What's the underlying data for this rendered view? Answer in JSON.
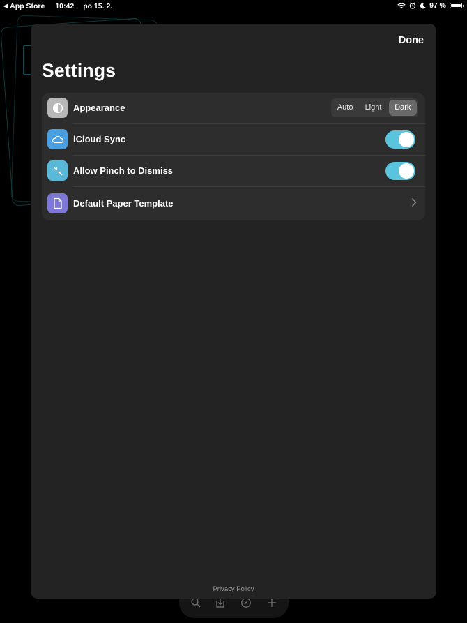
{
  "status_bar": {
    "back_label": "App Store",
    "time": "10:42",
    "date": "po 15. 2.",
    "battery": "97 %"
  },
  "sheet": {
    "done_label": "Done",
    "title": "Settings",
    "rows": [
      {
        "label": "Appearance",
        "icon": "contrast-icon"
      },
      {
        "label": "iCloud Sync",
        "icon": "cloud-icon",
        "toggle": true
      },
      {
        "label": "Allow Pinch to Dismiss",
        "icon": "pinch-icon",
        "toggle": true
      },
      {
        "label": "Default Paper Template",
        "icon": "document-icon"
      }
    ],
    "appearance_options": [
      "Auto",
      "Light",
      "Dark"
    ],
    "appearance_selected": "Dark",
    "privacy_label": "Privacy Policy"
  },
  "colors": {
    "toggle_on": "#5ac4de",
    "icloud_icon_bg": "#4a9fe0",
    "pinch_icon_bg": "#5ab8d8",
    "paper_icon_bg": "#7d78d8",
    "appearance_icon_bg": "#b8b8b8"
  }
}
